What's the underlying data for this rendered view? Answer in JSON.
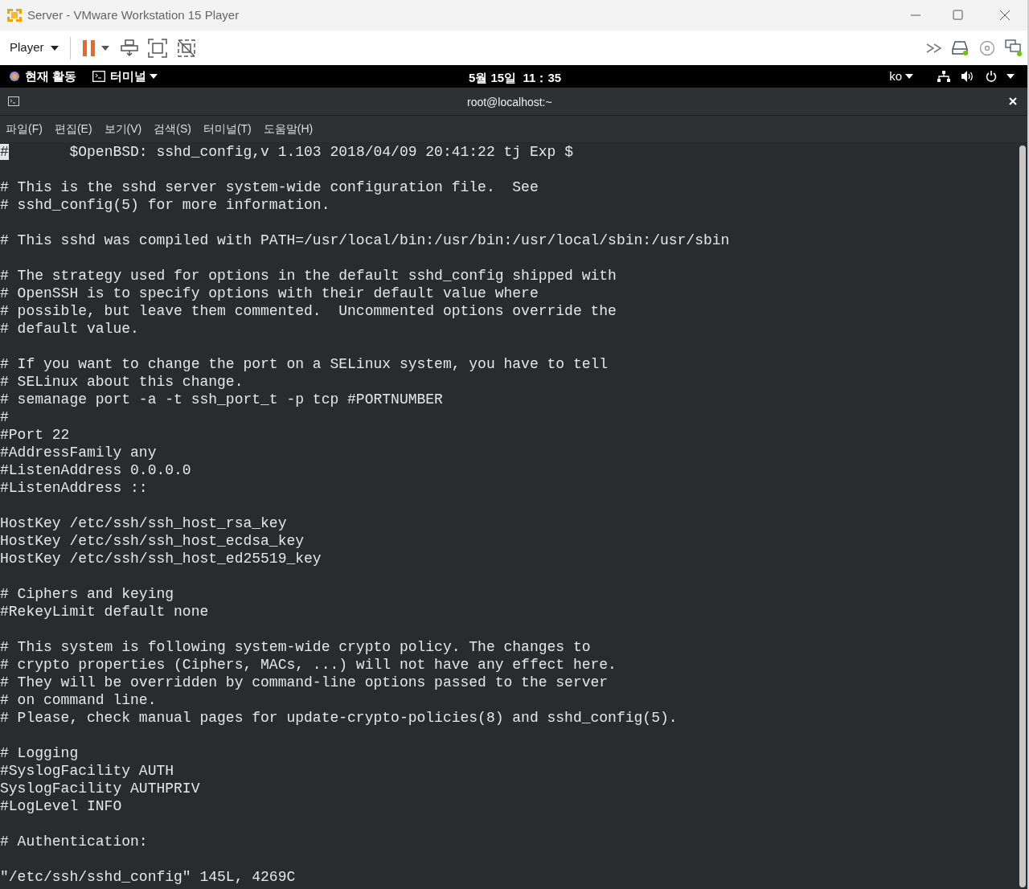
{
  "window": {
    "title": "Server - VMware Workstation 15 Player"
  },
  "toolbar": {
    "player_menu": "Player"
  },
  "gnome_bar": {
    "activities": "현재 활동",
    "app_menu": "터미널",
    "clock": "5월 15일  11：35",
    "input_method": "ko"
  },
  "terminal": {
    "title": "root@localhost:~",
    "menu": [
      "파일(F)",
      "편집(E)",
      "보기(V)",
      "검색(S)",
      "터미널(T)",
      "도움말(H)"
    ],
    "paragraphs": [
      [
        {
          "cursor": "#",
          "text": "       $OpenBSD: sshd_config,v 1.103 2018/04/09 20:41:22 tj Exp $"
        }
      ],
      [
        {
          "text": "# This is the sshd server system-wide configuration file.  See"
        },
        {
          "text": "# sshd_config(5) for more information."
        }
      ],
      [
        {
          "text": "# This sshd was compiled with PATH=/usr/local/bin:/usr/bin:/usr/local/sbin:/usr/sbin"
        }
      ],
      [
        {
          "text": "# The strategy used for options in the default sshd_config shipped with"
        },
        {
          "text": "# OpenSSH is to specify options with their default value where"
        },
        {
          "text": "# possible, but leave them commented.  Uncommented options override the"
        },
        {
          "text": "# default value."
        }
      ],
      [
        {
          "text": "# If you want to change the port on a SELinux system, you have to tell"
        },
        {
          "text": "# SELinux about this change."
        },
        {
          "text": "# semanage port -a -t ssh_port_t -p tcp #PORTNUMBER"
        },
        {
          "text": "#"
        },
        {
          "text": "#Port 22"
        },
        {
          "text": "#AddressFamily any"
        },
        {
          "text": "#ListenAddress 0.0.0.0"
        },
        {
          "text": "#ListenAddress ::"
        }
      ],
      [
        {
          "text": "HostKey /etc/ssh/ssh_host_rsa_key"
        },
        {
          "text": "HostKey /etc/ssh/ssh_host_ecdsa_key"
        },
        {
          "text": "HostKey /etc/ssh/ssh_host_ed25519_key"
        }
      ],
      [
        {
          "text": "# Ciphers and keying"
        },
        {
          "text": "#RekeyLimit default none"
        }
      ],
      [
        {
          "text": "# This system is following system-wide crypto policy. The changes to"
        },
        {
          "text": "# crypto properties (Ciphers, MACs, ...) will not have any effect here."
        },
        {
          "text": "# They will be overridden by command-line options passed to the server"
        },
        {
          "text": "# on command line."
        },
        {
          "text": "# Please, check manual pages for update-crypto-policies(8) and sshd_config(5)."
        }
      ],
      [
        {
          "text": "# Logging"
        },
        {
          "text": "#SyslogFacility AUTH"
        },
        {
          "text": "SyslogFacility AUTHPRIV"
        },
        {
          "text": "#LogLevel INFO"
        }
      ],
      [
        {
          "text": "# Authentication:"
        }
      ]
    ],
    "status_line": "\"/etc/ssh/sshd_config\" 145L, 4269C"
  }
}
